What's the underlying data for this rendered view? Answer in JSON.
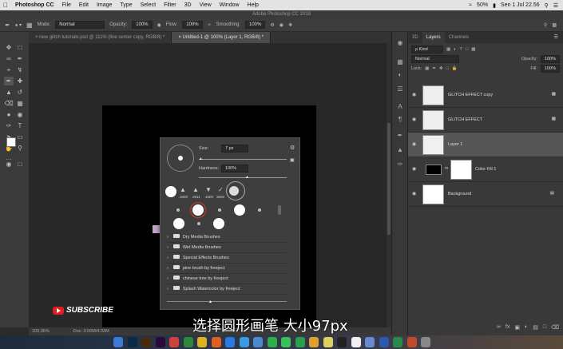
{
  "menubar": {
    "app": "Photoshop CC",
    "items": [
      "File",
      "Edit",
      "Image",
      "Type",
      "Select",
      "Filter",
      "3D",
      "View",
      "Window",
      "Help"
    ],
    "battery": "50%",
    "clock": "Sen 1 Jul  22.56"
  },
  "titlebar": {
    "title": "Adobe Photoshop CC 2018"
  },
  "options": {
    "mode_label": "Mode:",
    "mode_value": "Normal",
    "opacity_label": "Opacity:",
    "opacity_value": "100%",
    "flow_label": "Flow:",
    "flow_value": "100%",
    "smoothing_label": "Smoothing:",
    "smoothing_value": "100%"
  },
  "tabs": [
    {
      "label": "new glitch tutorials.psd @ 111% (line center copy, RGB/8) *"
    },
    {
      "label": "Untitled-1 @ 100% (Layer 1, RGB/8) *"
    }
  ],
  "status": {
    "zoom": "100,36%",
    "doc": "Doc: 3,00M/4,03M"
  },
  "layers_panel": {
    "tabs": [
      "3D",
      "Layers",
      "Channels"
    ],
    "kind_label": "ρ Kind",
    "blend_mode": "Normal",
    "opacity_label": "Opacity:",
    "opacity_value": "100%",
    "lock_label": "Lock:",
    "fill_label": "Fill:",
    "fill_value": "100%",
    "layers": [
      {
        "name": "GLITCH EFFECT copy"
      },
      {
        "name": "GLITCH EFFECT"
      },
      {
        "name": "Layer 1"
      },
      {
        "name": "Color Fill 1"
      },
      {
        "name": "Background"
      }
    ]
  },
  "brush_picker": {
    "size_label": "Size:",
    "size_value": "7 px",
    "hardness_label": "Hardness:",
    "hardness_value": "100%",
    "preset_sizes": [
      "2600",
      "2911",
      "4500",
      "3600"
    ],
    "folders": [
      "Dry Media Brushes",
      "Wet Media Brushes",
      "Special Effects Brushes",
      "pine brush by freeject",
      "chinese tree by freeject",
      "Splash Watercolor by freeject"
    ]
  },
  "overlay": {
    "subscribe": "SUBSCRIBE",
    "subtitle": "选择圆形画笔 大小97px"
  },
  "dock_icons": [
    "finder-icon",
    "photoshop-icon",
    "illustrator-icon",
    "premiere-icon",
    "music-icon",
    "sheets-icon",
    "chrome-icon",
    "firefox-icon",
    "appstore-icon",
    "safari-icon",
    "mail-icon",
    "whatsapp-icon",
    "messages-icon",
    "facetime-icon",
    "photos-icon",
    "notes-icon",
    "terminal-icon",
    "calendar-icon",
    "preview-icon",
    "word-icon",
    "excel-icon",
    "powerpoint-icon",
    "trash-icon"
  ]
}
